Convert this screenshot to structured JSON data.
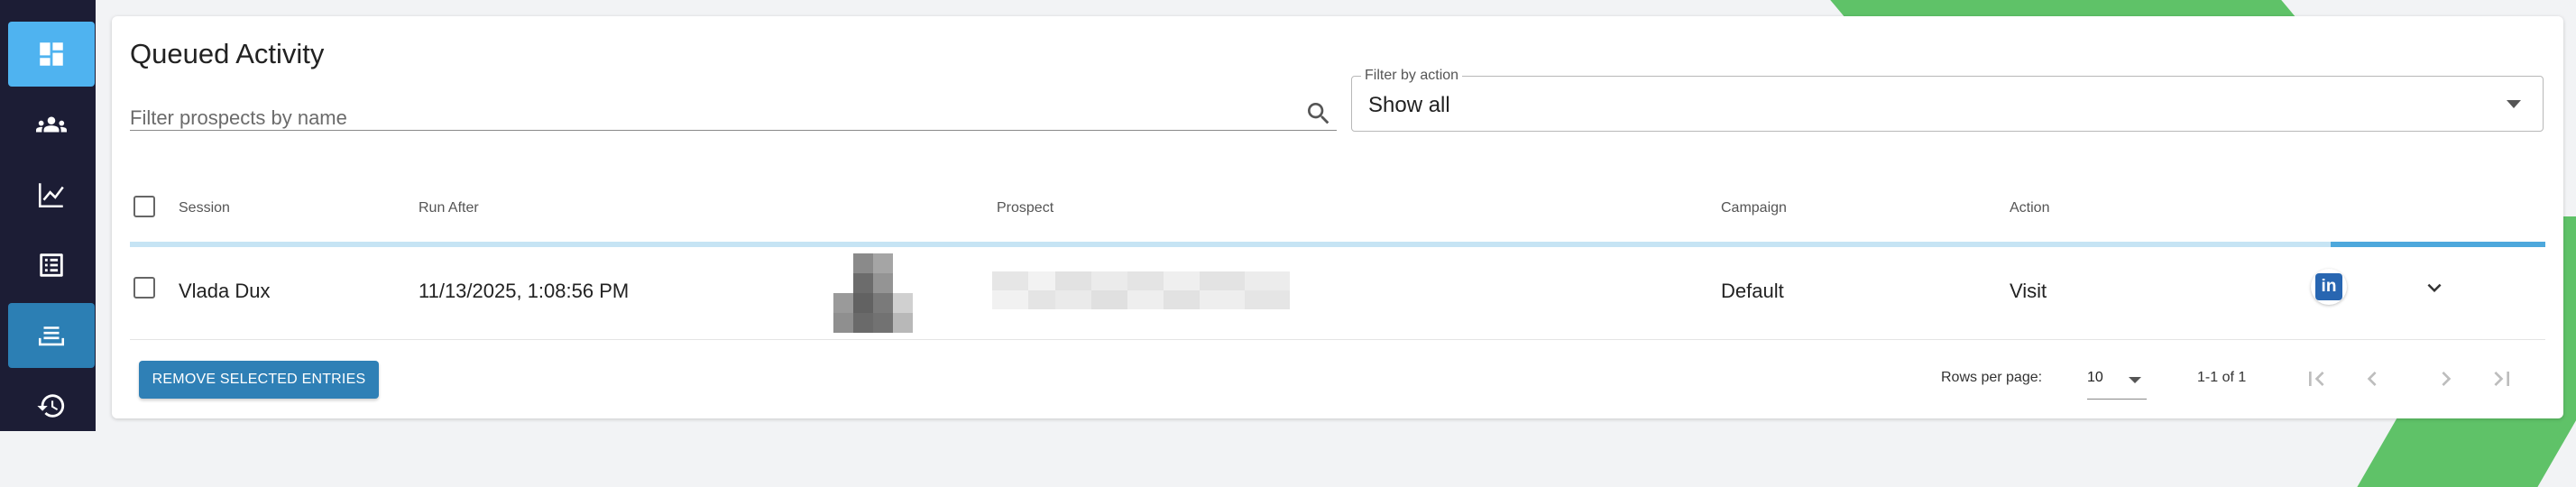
{
  "sidebar": {
    "items": [
      {
        "icon": "dashboard-icon",
        "state": "active"
      },
      {
        "icon": "people-icon",
        "state": "normal"
      },
      {
        "icon": "chart-line-icon",
        "state": "normal"
      },
      {
        "icon": "list-alt-icon",
        "state": "normal"
      },
      {
        "icon": "queue-icon",
        "state": "selected"
      },
      {
        "icon": "history-icon",
        "state": "normal"
      }
    ]
  },
  "page": {
    "title": "Queued Activity"
  },
  "search": {
    "placeholder": "Filter prospects by name"
  },
  "filter": {
    "label": "Filter by action",
    "value": "Show all"
  },
  "table": {
    "columns": [
      "Session",
      "Run After",
      "Prospect",
      "Campaign",
      "Action"
    ],
    "progress_fraction": 0.089,
    "rows": [
      {
        "session": "Vlada Dux",
        "run_after": "11/13/2025, 1:08:56 PM",
        "prospect": "",
        "campaign": "Default",
        "action": "Visit",
        "network_icon": "linkedin-icon"
      }
    ]
  },
  "footer": {
    "remove_button": "REMOVE SELECTED ENTRIES",
    "rows_per_page_label": "Rows per page:",
    "rows_per_page_value": "10",
    "page_info": "1-1 of 1"
  },
  "colors": {
    "sidebar_bg": "#1c1d35",
    "accent_active": "#4fb3f0",
    "accent_selected": "#2c7fb4",
    "button_bg": "#2f80b6",
    "progress_track": "#c6e4f4",
    "progress_fill": "#4da8dc",
    "decor_green": "#5fc268",
    "linkedin": "#2866b1"
  }
}
